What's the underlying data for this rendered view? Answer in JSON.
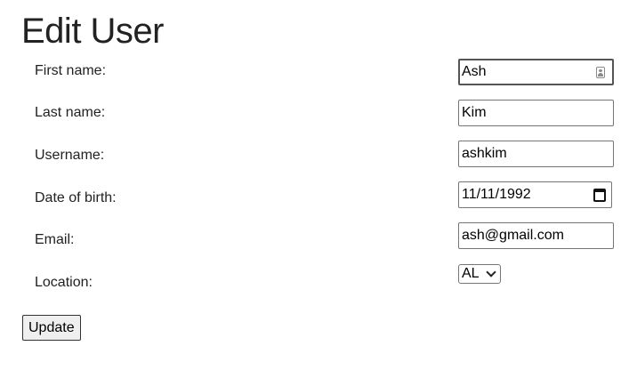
{
  "page": {
    "title": "Edit User"
  },
  "form": {
    "first_name": {
      "label": "First name:",
      "value": "Ash",
      "icon": "contact-card-icon"
    },
    "last_name": {
      "label": "Last name:",
      "value": "Kim"
    },
    "username": {
      "label": "Username:",
      "value": "ashkim"
    },
    "date_of_birth": {
      "label": "Date of birth:",
      "value": "11/11/1992",
      "icon": "calendar-icon"
    },
    "email": {
      "label": "Email:",
      "value": "ash@gmail.com"
    },
    "location": {
      "label": "Location:",
      "selected": "AL"
    },
    "submit_label": "Update"
  }
}
